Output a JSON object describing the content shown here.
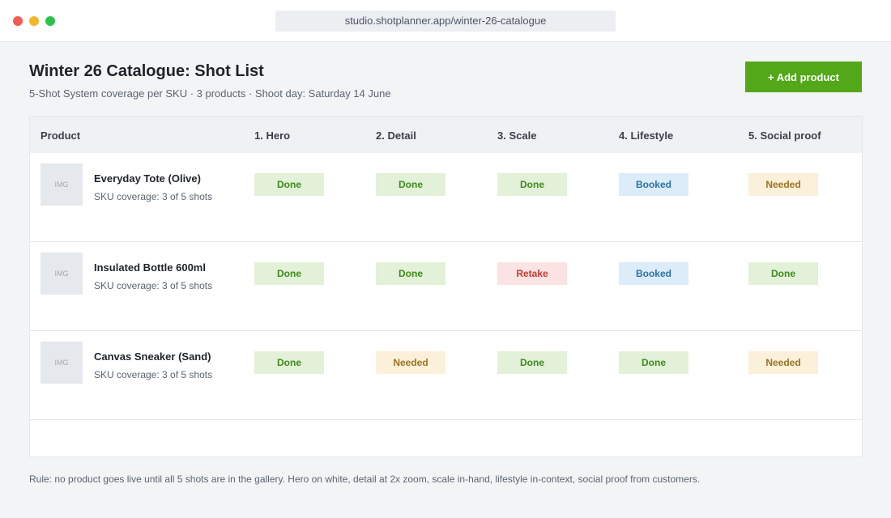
{
  "browser": {
    "url": "studio.shotplanner.app/winter-26-catalogue"
  },
  "page": {
    "title": "Winter 26 Catalogue: Shot List",
    "subtitle": "5-Shot System coverage per SKU · 3 products · Shoot day: Saturday 14 June",
    "add_button_label": "+ Add product"
  },
  "table": {
    "headers": [
      "Product",
      "1. Hero",
      "2. Detail",
      "3. Scale",
      "4. Lifestyle",
      "5. Social proof"
    ],
    "rows": [
      {
        "thumb": "IMG",
        "name": "Everyday Tote (Olive)",
        "coverage": "SKU coverage: 3 of 5 shots",
        "shots": [
          "Done",
          "Done",
          "Done",
          "Booked",
          "Needed"
        ]
      },
      {
        "thumb": "IMG",
        "name": "Insulated Bottle 600ml",
        "coverage": "SKU coverage: 3 of 5 shots",
        "shots": [
          "Done",
          "Done",
          "Retake",
          "Booked",
          "Done"
        ]
      },
      {
        "thumb": "IMG",
        "name": "Canvas Sneaker (Sand)",
        "coverage": "SKU coverage: 3 of 5 shots",
        "shots": [
          "Done",
          "Needed",
          "Done",
          "Done",
          "Needed"
        ]
      }
    ]
  },
  "footer": {
    "rule": "Rule: no product goes live until all 5 shots are in the gallery. Hero on white, detail at 2x zoom, scale in-hand, lifestyle in-context, social proof from customers."
  },
  "status_colors": {
    "Done": "#3f8a1a",
    "Booked": "#2a72a8",
    "Needed": "#9c7320",
    "Retake": "#c23a32",
    "accent": "#52a818"
  }
}
